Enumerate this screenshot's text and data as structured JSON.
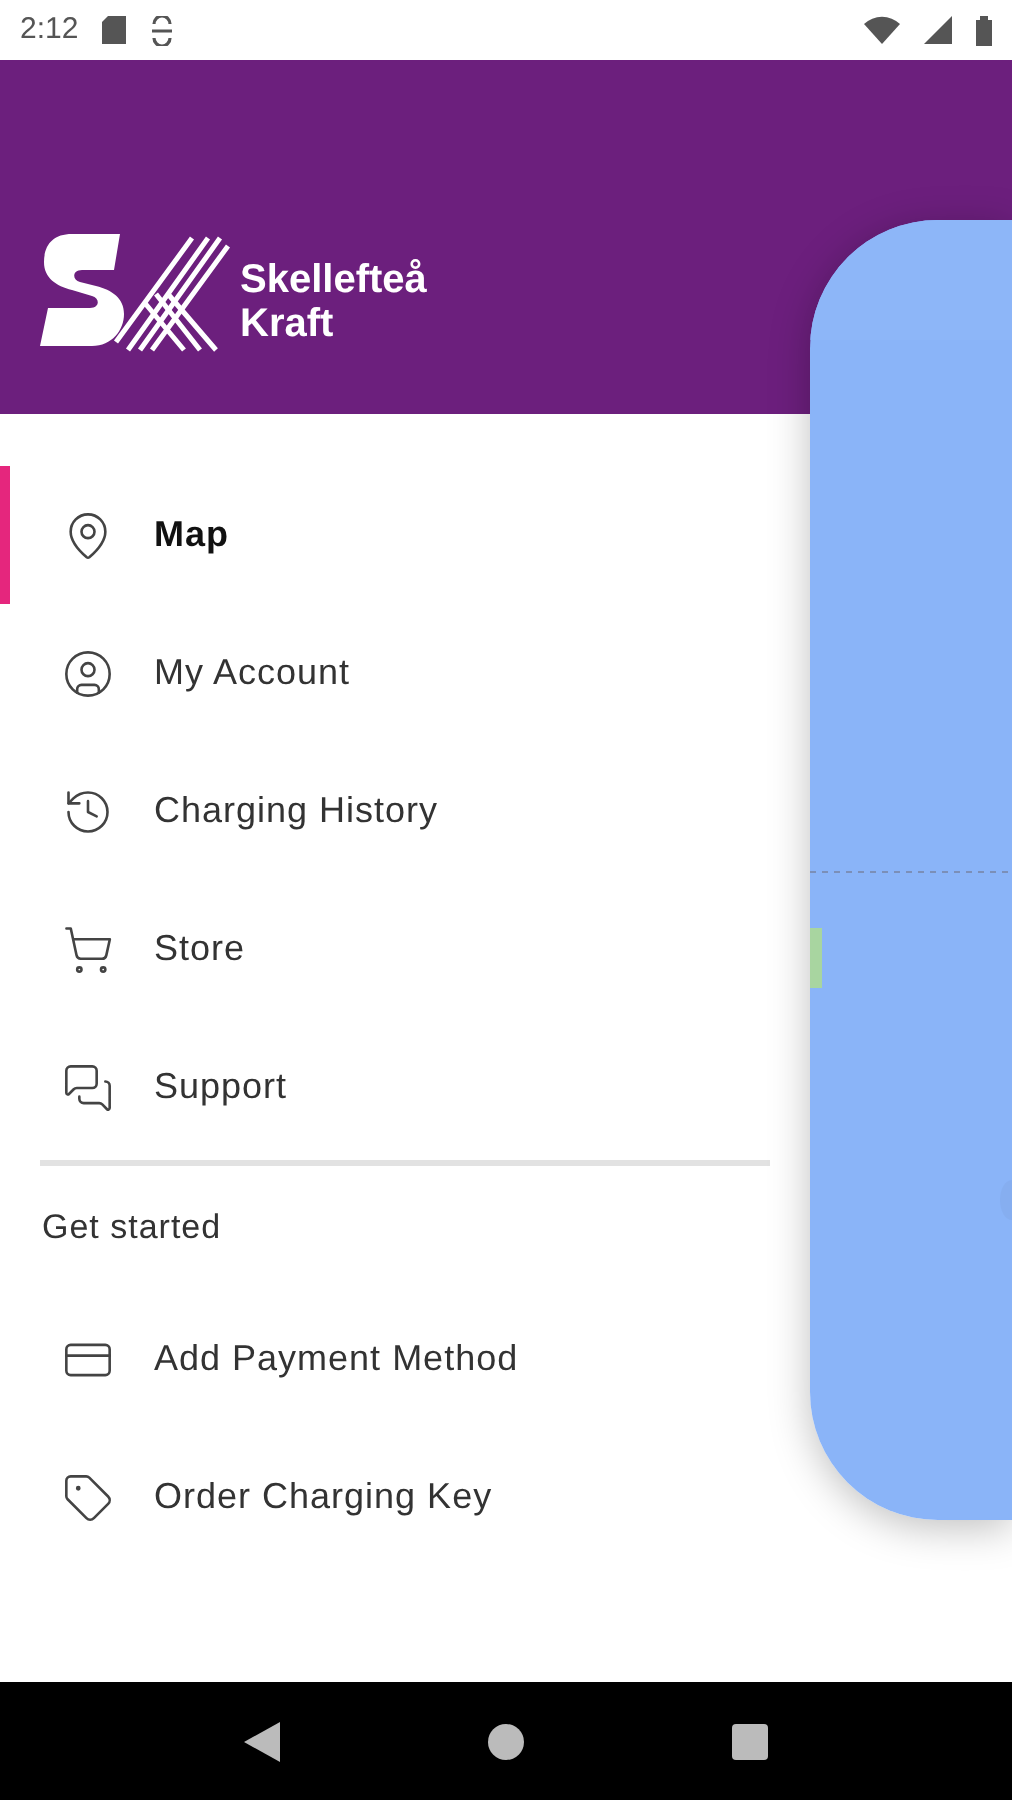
{
  "status_bar": {
    "time": "2:12"
  },
  "header": {
    "brand_lines": [
      "Skellefteå",
      "Kraft"
    ]
  },
  "menu": [
    {
      "label": "Map",
      "selected": true
    },
    {
      "label": "My Account",
      "selected": false
    },
    {
      "label": "Charging History",
      "selected": false
    },
    {
      "label": "Store",
      "selected": false
    },
    {
      "label": "Support",
      "selected": false
    }
  ],
  "section_title": "Get started",
  "secondary_menu": [
    {
      "label": "Add Payment Method",
      "selected": false
    },
    {
      "label": "Order Charging Key",
      "selected": false
    }
  ]
}
